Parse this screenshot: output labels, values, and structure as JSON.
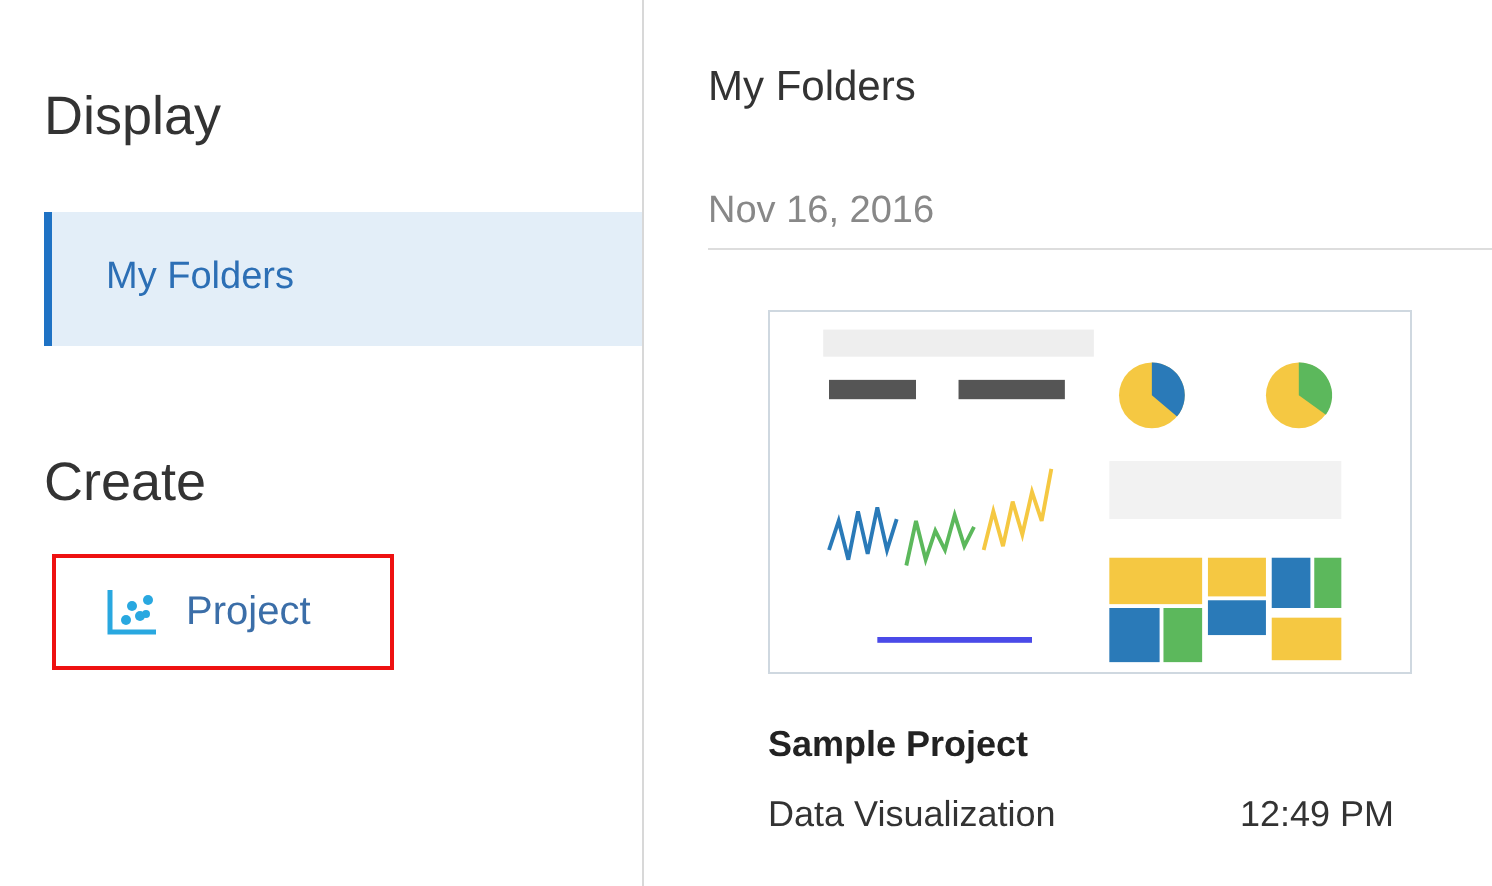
{
  "sidebar": {
    "display_heading": "Display",
    "items": [
      {
        "label": "My Folders",
        "selected": true
      }
    ],
    "create_heading": "Create",
    "create_items": [
      {
        "label": "Project",
        "highlighted": true
      }
    ]
  },
  "main": {
    "title": "My Folders",
    "date_group": "Nov 16, 2016",
    "cards": [
      {
        "title": "Sample Project",
        "type": "Data Visualization",
        "time": "12:49 PM"
      }
    ]
  }
}
